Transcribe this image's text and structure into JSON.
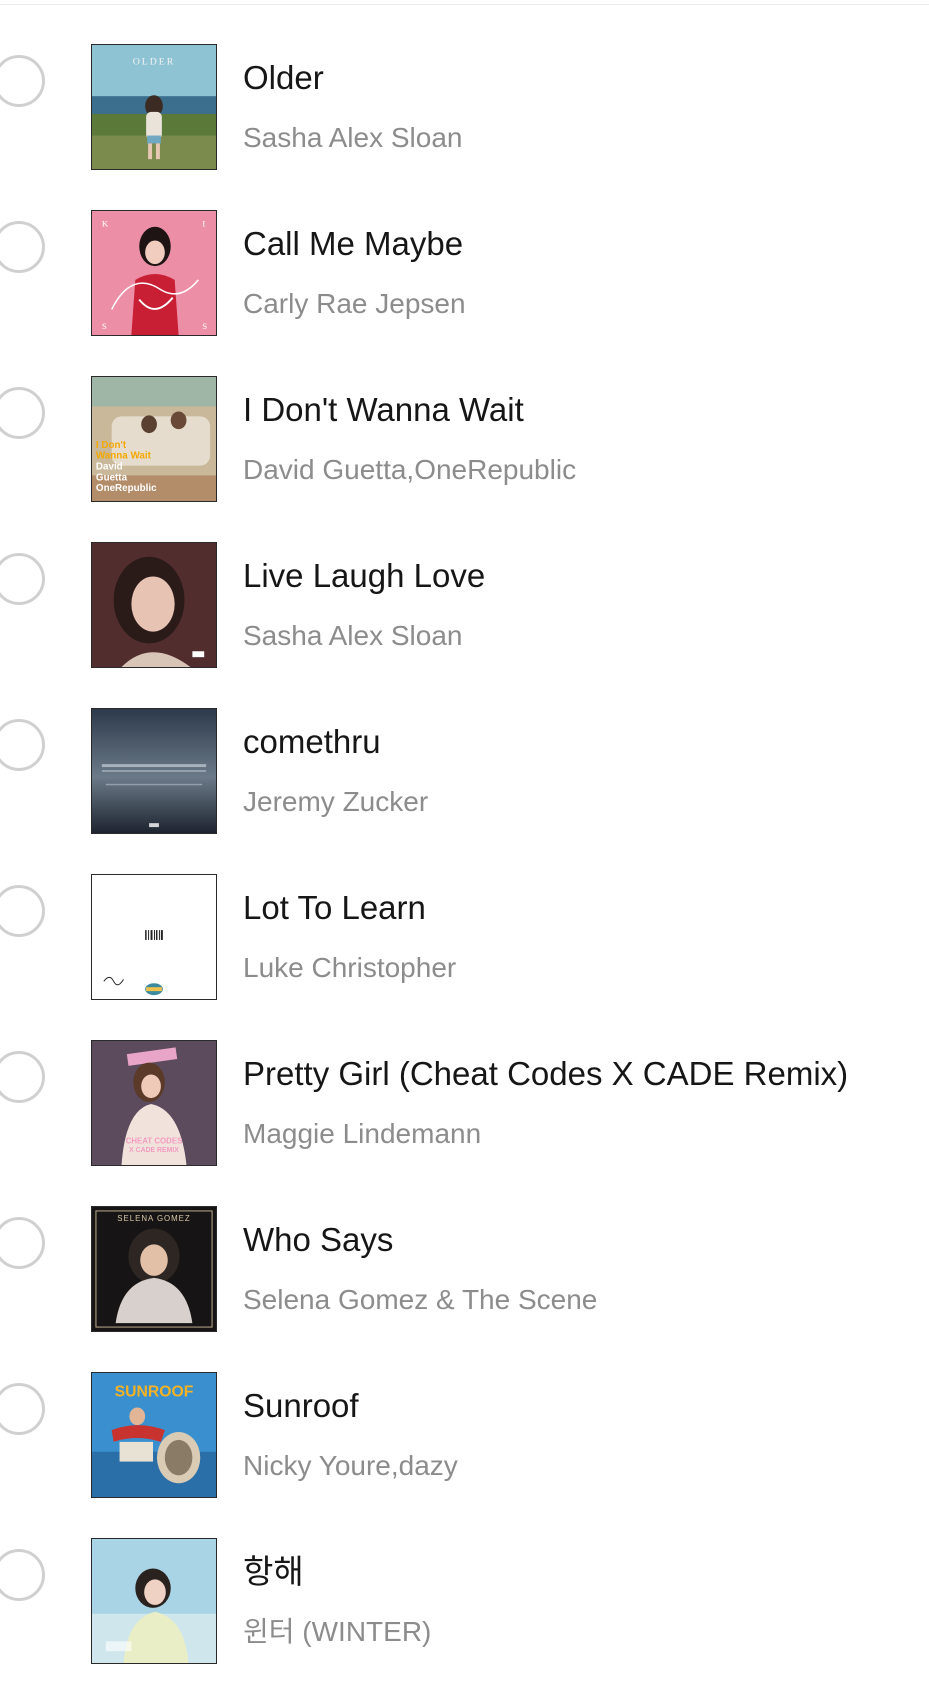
{
  "songs": [
    {
      "title": "Older",
      "artist": "Sasha Alex Sloan",
      "cover_icon": "album-cover-older",
      "cover_text": "OLDER"
    },
    {
      "title": "Call Me Maybe",
      "artist": "Carly Rae Jepsen",
      "cover_icon": "album-cover-kiss",
      "cover_text": "KISS"
    },
    {
      "title": "I Don't Wanna Wait",
      "artist": "David Guetta,OneRepublic",
      "cover_icon": "album-cover-i-dont-wanna-wait",
      "cover_text": "I Don't Wanna Wait David Guetta OneRepublic"
    },
    {
      "title": "Live Laugh Love",
      "artist": "Sasha Alex Sloan",
      "cover_icon": "album-cover-live-laugh-love"
    },
    {
      "title": "comethru",
      "artist": "Jeremy Zucker",
      "cover_icon": "album-cover-comethru"
    },
    {
      "title": "Lot To Learn",
      "artist": "Luke Christopher",
      "cover_icon": "album-cover-lot-to-learn"
    },
    {
      "title": "Pretty Girl (Cheat Codes X CADE Remix)",
      "artist": "Maggie Lindemann",
      "cover_icon": "album-cover-pretty-girl",
      "cover_text": "CHEAT CODES X CADE REMIX"
    },
    {
      "title": "Who Says",
      "artist": "Selena Gomez & The Scene",
      "cover_icon": "album-cover-who-says",
      "cover_text": "SELENA GOMEZ"
    },
    {
      "title": "Sunroof",
      "artist": "Nicky Youre,dazy",
      "cover_icon": "album-cover-sunroof",
      "cover_text": "SUNROOF"
    },
    {
      "title": "항해",
      "artist": "윈터 (WINTER)",
      "cover_icon": "album-cover-hanghae"
    }
  ],
  "colors": {
    "title": "#161616",
    "artist": "#8c8c8c",
    "radio_border": "#d0d0d0",
    "background": "#ffffff"
  }
}
